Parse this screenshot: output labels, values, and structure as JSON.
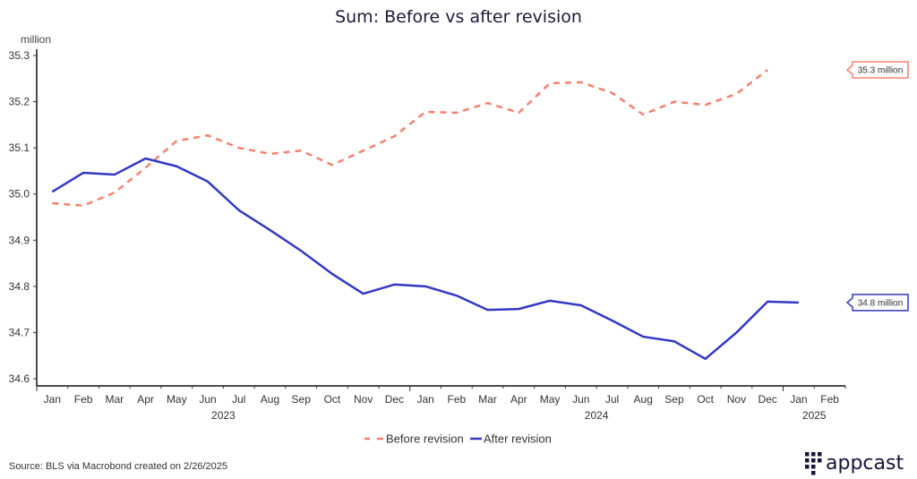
{
  "chart_data": {
    "type": "line",
    "title": "Sum: Before vs after revision",
    "ylabel": "million",
    "xlabel": "",
    "ylim": [
      34.6,
      35.3
    ],
    "yticks": [
      "34.6",
      "34.7",
      "34.8",
      "34.9",
      "35.0",
      "35.1",
      "35.2",
      "35.3"
    ],
    "grid": false,
    "x_month_labels": [
      "Jan",
      "Feb",
      "Mar",
      "Apr",
      "May",
      "Jun",
      "Jul",
      "Aug",
      "Sep",
      "Oct",
      "Nov",
      "Dec",
      "Jan",
      "Feb",
      "Mar",
      "Apr",
      "May",
      "Jun",
      "Jul",
      "Aug",
      "Sep",
      "Oct",
      "Nov",
      "Dec",
      "Jan",
      "Feb"
    ],
    "x_year_labels": [
      {
        "label": "2023",
        "center_month_index": 5.5
      },
      {
        "label": "2024",
        "center_month_index": 17.5
      },
      {
        "label": "2025",
        "center_month_index": 24.5
      }
    ],
    "series": [
      {
        "name": "Before revision",
        "color": "#F6806F",
        "style": "dashed",
        "start_month_index": 0,
        "values": [
          34.98,
          34.975,
          35.003,
          35.057,
          35.115,
          35.127,
          35.1,
          35.087,
          35.094,
          35.063,
          35.094,
          35.125,
          35.178,
          35.176,
          35.197,
          35.176,
          35.24,
          35.242,
          35.219,
          35.172,
          35.2,
          35.193,
          35.217,
          35.269
        ],
        "end_callout": "35.3 million"
      },
      {
        "name": "After revision",
        "color": "#3338C2",
        "style": "solid",
        "start_month_index": 0,
        "values": [
          35.005,
          35.046,
          35.042,
          35.077,
          35.06,
          35.027,
          34.965,
          34.922,
          34.877,
          34.827,
          34.784,
          34.804,
          34.8,
          34.78,
          34.749,
          34.751,
          34.769,
          34.759,
          34.726,
          34.691,
          34.681,
          34.643,
          34.7,
          34.767,
          34.765
        ],
        "end_callout": "34.8 million"
      }
    ],
    "legend_position": "bottom-center"
  },
  "footer": {
    "source": "Source: BLS via Macrobond created on 2/26/2025",
    "logo_text": "appcast"
  }
}
